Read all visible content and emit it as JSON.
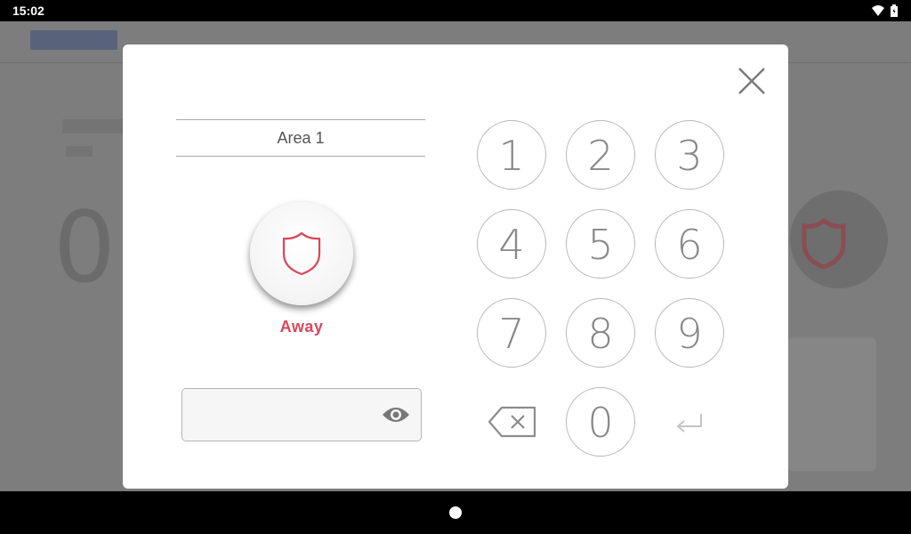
{
  "status_bar": {
    "time": "15:02",
    "icons": [
      "wifi-icon",
      "battery-icon"
    ]
  },
  "modal": {
    "area_label": "Area 1",
    "mode": {
      "label": "Away",
      "icon": "shield-icon",
      "color": "#d9475a"
    },
    "code_input": {
      "value": "",
      "placeholder": ""
    },
    "keypad": {
      "keys": [
        "1",
        "2",
        "3",
        "4",
        "5",
        "6",
        "7",
        "8",
        "9",
        "0"
      ],
      "backspace_icon": "backspace-icon",
      "enter_icon": "enter-icon"
    },
    "close_icon": "close-icon"
  },
  "nav_bar": {
    "home_icon": "home-dot"
  }
}
